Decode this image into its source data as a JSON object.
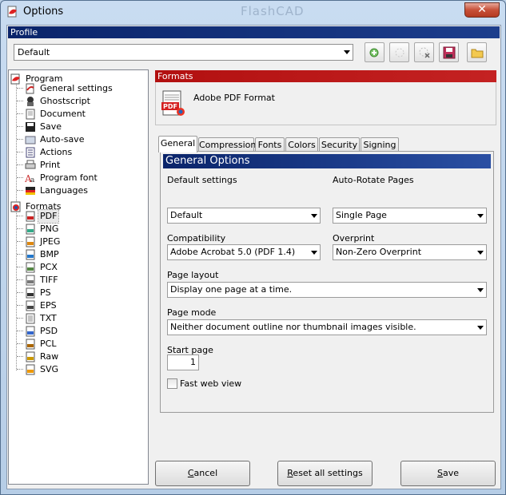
{
  "window": {
    "title": "Options",
    "watermark": "FlashCAD",
    "close_glyph": "✕"
  },
  "profile": {
    "header": "Profile",
    "selected": "Default"
  },
  "tree": {
    "program": {
      "label": "Program",
      "items": [
        "General settings",
        "Ghostscript",
        "Document",
        "Save",
        "Auto-save",
        "Actions",
        "Print",
        "Program font",
        "Languages"
      ]
    },
    "formats": {
      "label": "Formats",
      "items": [
        "PDF",
        "PNG",
        "JPEG",
        "BMP",
        "PCX",
        "TIFF",
        "PS",
        "EPS",
        "TXT",
        "PSD",
        "PCL",
        "Raw",
        "SVG"
      ]
    }
  },
  "formats_panel": {
    "header": "Formats",
    "format_name": "Adobe PDF Format"
  },
  "tabs": [
    "General",
    "Compression",
    "Fonts",
    "Colors",
    "Security",
    "Signing"
  ],
  "general": {
    "header": "General Options",
    "default_settings": {
      "label": "Default settings",
      "value": "Default"
    },
    "auto_rotate": {
      "label": "Auto-Rotate Pages",
      "value": "Single Page"
    },
    "compatibility": {
      "label": "Compatibility",
      "value": "Adobe Acrobat 5.0 (PDF 1.4)"
    },
    "overprint": {
      "label": "Overprint",
      "value": "Non-Zero Overprint"
    },
    "page_layout": {
      "label": "Page layout",
      "value": "Display one page at a time."
    },
    "page_mode": {
      "label": "Page mode",
      "value": "Neither document outline nor thumbnail images visible."
    },
    "start_page": {
      "label": "Start page",
      "value": "1"
    },
    "fast_web_view": {
      "label": "Fast web view"
    }
  },
  "buttons": {
    "cancel": {
      "key": "C",
      "rest": "ancel"
    },
    "reset": {
      "key": "R",
      "rest": "eset all settings"
    },
    "save": {
      "key": "S",
      "rest": "ave"
    }
  },
  "colors": {
    "profile_header": "#0a246a",
    "formats_header": "#b21010",
    "selection": "#e8e8e8"
  }
}
